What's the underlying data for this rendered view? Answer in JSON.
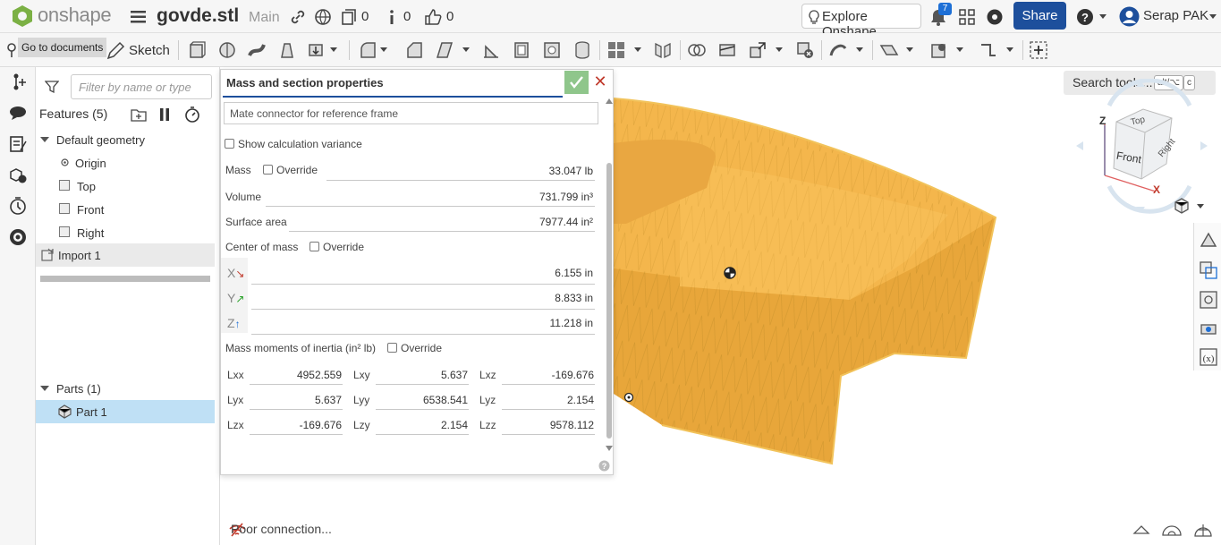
{
  "topbar": {
    "logo_text": "onshape",
    "doc_name": "govde.stl",
    "branch": "Main",
    "doc_count": "0",
    "info_count": "0",
    "likes_count": "0",
    "explore_label": "Explore Onshape",
    "notif_count": "7",
    "share_label": "Share",
    "user_name": "Serap PAK"
  },
  "toolbar": {
    "tooltip": "Go to documents",
    "sketch_label": "Sketch",
    "search_label": "Search tools...",
    "kbd1": "alt/⌥",
    "kbd2": "c"
  },
  "features": {
    "filter_placeholder": "Filter by name or type",
    "header": "Features (5)",
    "default_geometry": "Default geometry",
    "items": [
      "Origin",
      "Top",
      "Front",
      "Right"
    ],
    "import": "Import 1",
    "parts_header": "Parts (1)",
    "part": "Part 1"
  },
  "dialog": {
    "title": "Mass and section properties",
    "mate_connector": "Mate connector for reference frame",
    "show_variance": "Show calculation variance",
    "mass_label": "Mass",
    "override": "Override",
    "mass_value": "33.047 lb",
    "volume_label": "Volume",
    "volume_value": "731.799 in³",
    "area_label": "Surface area",
    "area_value": "7977.44 in²",
    "com_label": "Center of mass",
    "x_label": "X",
    "y_label": "Y",
    "z_label": "Z",
    "com_x": "6.155 in",
    "com_y": "8.833 in",
    "com_z": "11.218 in",
    "moi_label": "Mass moments of inertia (in² lb)",
    "moi": [
      [
        {
          "k": "Lxx",
          "v": "4952.559"
        },
        {
          "k": "Lxy",
          "v": "5.637"
        },
        {
          "k": "Lxz",
          "v": "-169.676"
        }
      ],
      [
        {
          "k": "Lyx",
          "v": "5.637"
        },
        {
          "k": "Lyy",
          "v": "6538.541"
        },
        {
          "k": "Lyz",
          "v": "2.154"
        }
      ],
      [
        {
          "k": "Lzx",
          "v": "-169.676"
        },
        {
          "k": "Lzy",
          "v": "2.154"
        },
        {
          "k": "Lzz",
          "v": "9578.112"
        }
      ]
    ]
  },
  "viewcube": {
    "top": "Top",
    "front": "Front",
    "right": "Right",
    "axis_z": "Z",
    "axis_x": "X"
  },
  "status_text": "Poor connection...",
  "colors": {
    "accent": "#1d4f9c",
    "part": "#f2b246",
    "selected": "#bfe0f5"
  }
}
